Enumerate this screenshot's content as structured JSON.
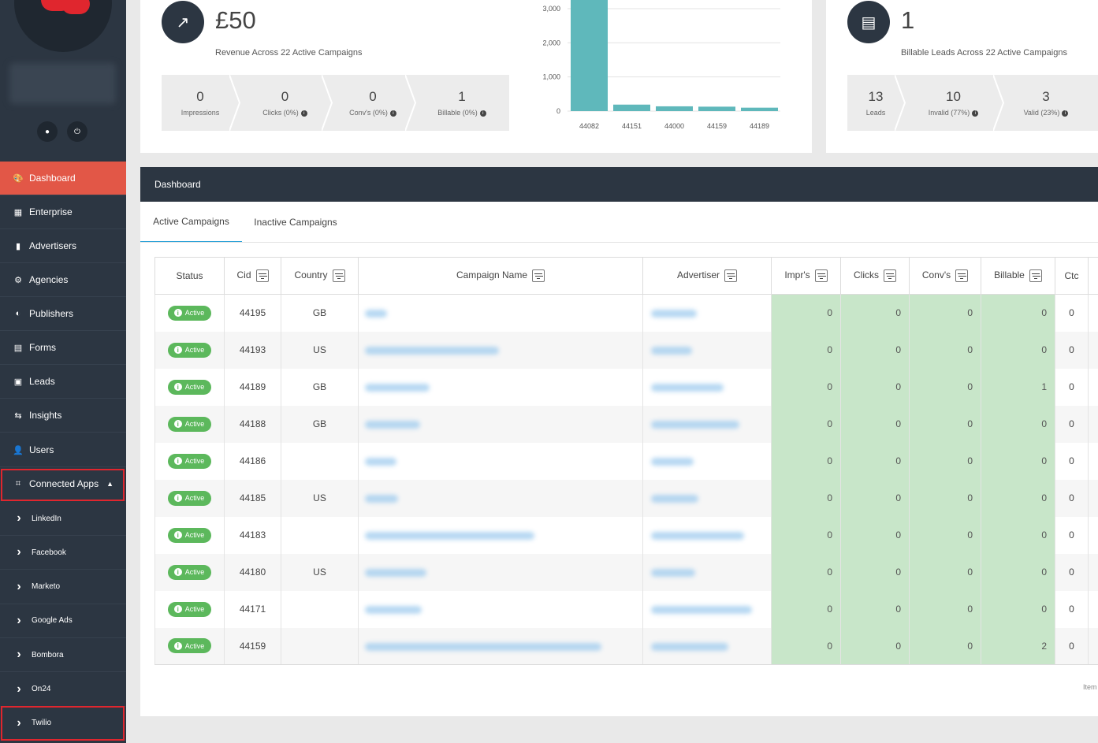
{
  "sidebar": {
    "items": [
      {
        "label": "Dashboard",
        "icon": "palette-icon",
        "glyph": "🎨",
        "active": true
      },
      {
        "label": "Enterprise",
        "icon": "building-icon",
        "glyph": "▦"
      },
      {
        "label": "Advertisers",
        "icon": "info-card-icon",
        "glyph": "▮"
      },
      {
        "label": "Agencies",
        "icon": "cogs-icon",
        "glyph": "⚙"
      },
      {
        "label": "Publishers",
        "icon": "magnet-icon",
        "glyph": "◐"
      },
      {
        "label": "Forms",
        "icon": "form-icon",
        "glyph": "▤"
      },
      {
        "label": "Leads",
        "icon": "address-card-icon",
        "glyph": "▣"
      },
      {
        "label": "Insights",
        "icon": "sitemap-icon",
        "glyph": "⇆"
      },
      {
        "label": "Users",
        "icon": "users-icon",
        "glyph": "👤"
      },
      {
        "label": "Connected Apps",
        "icon": "crop-icon",
        "glyph": "⌗"
      }
    ],
    "sub_items": [
      {
        "label": "LinkedIn"
      },
      {
        "label": "Facebook"
      },
      {
        "label": "Marketo"
      },
      {
        "label": "Google Ads"
      },
      {
        "label": "Bombora"
      },
      {
        "label": "On24"
      },
      {
        "label": "Twilio"
      }
    ]
  },
  "revenue_card": {
    "value": "£50",
    "caption": "Revenue Across 22 Active Campaigns",
    "icon": "chart-line-icon",
    "stats": [
      {
        "value": "0",
        "label": "Impressions"
      },
      {
        "value": "0",
        "label": "Clicks (0%)"
      },
      {
        "value": "0",
        "label": "Conv's (0%)"
      },
      {
        "value": "1",
        "label": "Billable (0%)"
      }
    ]
  },
  "billable_card": {
    "value": "1",
    "caption": "Billable Leads Across 22 Active Campaigns",
    "icon": "id-card-icon",
    "stats": [
      {
        "value": "13",
        "label": "Leads"
      },
      {
        "value": "10",
        "label": "Invalid (77%)"
      },
      {
        "value": "3",
        "label": "Valid (23%)"
      }
    ]
  },
  "chart_data": {
    "type": "bar",
    "categories": [
      "44082",
      "44151",
      "44000",
      "44159",
      "44189"
    ],
    "values": [
      3300,
      190,
      140,
      130,
      100
    ],
    "yticks": [
      "0",
      "1,000",
      "2,000",
      "3,000"
    ],
    "ylim": [
      0,
      3300
    ],
    "color": "#5fb8bb"
  },
  "panel": {
    "title": "Dashboard",
    "tabs": {
      "active": "Active Campaigns",
      "inactive": "Inactive Campaigns"
    },
    "columns": [
      "Status",
      "Cid",
      "Country",
      "Campaign Name",
      "Advertiser",
      "Impr's",
      "Clicks",
      "Conv's",
      "Billable",
      "Ctc"
    ],
    "rows": [
      {
        "status": "Active",
        "cid": "44195",
        "country": "GB",
        "impr": "0",
        "clicks": "0",
        "convs": "0",
        "billable": "0",
        "ctc": "0"
      },
      {
        "status": "Active",
        "cid": "44193",
        "country": "US",
        "impr": "0",
        "clicks": "0",
        "convs": "0",
        "billable": "0",
        "ctc": "0"
      },
      {
        "status": "Active",
        "cid": "44189",
        "country": "GB",
        "impr": "0",
        "clicks": "0",
        "convs": "0",
        "billable": "1",
        "ctc": "0"
      },
      {
        "status": "Active",
        "cid": "44188",
        "country": "GB",
        "impr": "0",
        "clicks": "0",
        "convs": "0",
        "billable": "0",
        "ctc": "0"
      },
      {
        "status": "Active",
        "cid": "44186",
        "country": "",
        "impr": "0",
        "clicks": "0",
        "convs": "0",
        "billable": "0",
        "ctc": "0"
      },
      {
        "status": "Active",
        "cid": "44185",
        "country": "US",
        "impr": "0",
        "clicks": "0",
        "convs": "0",
        "billable": "0",
        "ctc": "0"
      },
      {
        "status": "Active",
        "cid": "44183",
        "country": "",
        "impr": "0",
        "clicks": "0",
        "convs": "0",
        "billable": "0",
        "ctc": "0"
      },
      {
        "status": "Active",
        "cid": "44180",
        "country": "US",
        "impr": "0",
        "clicks": "0",
        "convs": "0",
        "billable": "0",
        "ctc": "0"
      },
      {
        "status": "Active",
        "cid": "44171",
        "country": "",
        "impr": "0",
        "clicks": "0",
        "convs": "0",
        "billable": "0",
        "ctc": "0"
      },
      {
        "status": "Active",
        "cid": "44159",
        "country": "",
        "impr": "0",
        "clicks": "0",
        "convs": "0",
        "billable": "2",
        "ctc": "0"
      }
    ],
    "footer_text": "Item"
  }
}
